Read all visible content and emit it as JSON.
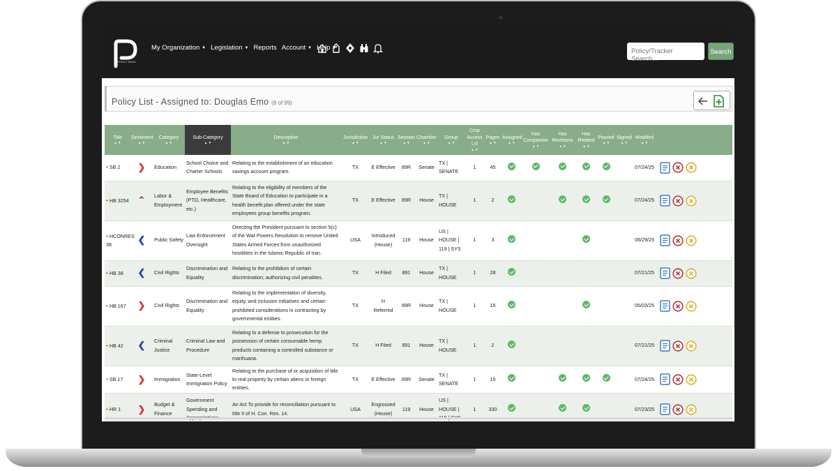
{
  "nav": {
    "brand": "POLICY RACE",
    "menu": [
      {
        "label": "My Organization",
        "caret": true
      },
      {
        "label": "Legislation",
        "caret": true
      },
      {
        "label": "Reports",
        "caret": false
      },
      {
        "label": "Account",
        "caret": true
      },
      {
        "label": "Help",
        "caret": true
      }
    ],
    "icons": [
      "home-icon",
      "tag-icon",
      "shapes-icon",
      "binoculars-icon",
      "bell-icon"
    ],
    "search_placeholder": "Policy/Tracker Search...",
    "search_button": "Search",
    "accent": "#7aa57a"
  },
  "page": {
    "title": "Policy List - Assigned to: Douglas Emo",
    "count": "(8 of 99)"
  },
  "table": {
    "header_color": "#88ad88",
    "sort_marker": "▲ ▼",
    "columns": [
      "Title",
      "Sentiment",
      "Category",
      "Sub-Category",
      "Description",
      "Jurisdiction",
      "Jur Status",
      "Session",
      "Chamber",
      "Group",
      "Cmp Access Lvl",
      "Pages",
      "Assigned",
      "Has Companion",
      "Has Revisions",
      "Has Related",
      "Passed",
      "Signed",
      "Modified"
    ],
    "rows": [
      {
        "title": "SB 2",
        "sentiment": "right",
        "category": "Education",
        "subcategory": "School Choice and Charter Schools",
        "description": "Relating to the establishment of an education savings account program.",
        "jurisdiction": "TX",
        "jur_status": "E Effective",
        "session": "89R",
        "chamber": "Senate",
        "group": "TX | SENATE",
        "access": "1",
        "pages": "45",
        "assigned": true,
        "companion": true,
        "revisions": true,
        "related": true,
        "passed": true,
        "signed": false,
        "modified": "07/24/25"
      },
      {
        "title": "HB 3254",
        "sentiment": "up",
        "category": "Labor & Employment",
        "subcategory": "Employee Benefits (PTO, Healthcare, etc.)",
        "description": "Relating to the eligibility of members of the State Board of Education to participate in a health benefit plan offered under the state employees group benefits program.",
        "jurisdiction": "TX",
        "jur_status": "E Effective",
        "session": "89R",
        "chamber": "House",
        "group": "TX | HOUSE",
        "access": "1",
        "pages": "2",
        "assigned": true,
        "companion": false,
        "revisions": true,
        "related": true,
        "passed": true,
        "signed": false,
        "modified": "07/24/25"
      },
      {
        "title": "HCONRES 38",
        "sentiment": "left",
        "category": "Public Safety",
        "subcategory": "Law Enforcement Oversight",
        "description": "Directing the President pursuant to section 5(c) of the War Powers Resolution to remove United States Armed Forces from unauthorized hostilities in the Islamic Republic of Iran.",
        "jurisdiction": "USA",
        "jur_status": "Introduced (House)",
        "session": "119",
        "chamber": "House",
        "group": "US | HOUSE | 119 | SYS",
        "access": "1",
        "pages": "3",
        "assigned": true,
        "companion": false,
        "revisions": false,
        "related": true,
        "passed": false,
        "signed": false,
        "modified": "06/29/25"
      },
      {
        "title": "HB 38",
        "sentiment": "left",
        "category": "Civil Rights",
        "subcategory": "Discrimination and Equality",
        "description": "Relating to the prohibition of certain discrimination; authorizing civil penalties.",
        "jurisdiction": "TX",
        "jur_status": "H Filed",
        "session": "891",
        "chamber": "House",
        "group": "TX | HOUSE",
        "access": "1",
        "pages": "28",
        "assigned": true,
        "companion": false,
        "revisions": false,
        "related": false,
        "passed": false,
        "signed": false,
        "modified": "07/21/25"
      },
      {
        "title": "HB 167",
        "sentiment": "right",
        "category": "Civil Rights",
        "subcategory": "Discrimination and Equality",
        "description": "Relating to the implementation of diversity, equity, and inclusion initiatives and certain prohibited considerations in contracting by governmental entities.",
        "jurisdiction": "TX",
        "jur_status": "H Referred",
        "session": "89R",
        "chamber": "House",
        "group": "TX | HOUSE",
        "access": "1",
        "pages": "15",
        "assigned": true,
        "companion": false,
        "revisions": false,
        "related": true,
        "passed": false,
        "signed": false,
        "modified": "05/03/25"
      },
      {
        "title": "HB 42",
        "sentiment": "left",
        "category": "Criminal Justice",
        "subcategory": "Criminal Law and Procedure",
        "description": "Relating to a defense to prosecution for the possession of certain consumable hemp products containing a controlled substance or marihuana.",
        "jurisdiction": "TX",
        "jur_status": "H Filed",
        "session": "891",
        "chamber": "House",
        "group": "TX | HOUSE",
        "access": "1",
        "pages": "2",
        "assigned": true,
        "companion": false,
        "revisions": false,
        "related": false,
        "passed": false,
        "signed": false,
        "modified": "07/21/25"
      },
      {
        "title": "SB 17",
        "sentiment": "right",
        "category": "Immigration",
        "subcategory": "State-Level Immigration Policy",
        "description": "Relating to the purchase of or acquisition of title to real property by certain aliens or foreign entities.",
        "jurisdiction": "TX",
        "jur_status": "E Effective",
        "session": "89R",
        "chamber": "Senate",
        "group": "TX | SENATE",
        "access": "1",
        "pages": "15",
        "assigned": true,
        "companion": false,
        "revisions": true,
        "related": true,
        "passed": true,
        "signed": false,
        "modified": "07/24/25"
      },
      {
        "title": "HR 1",
        "sentiment": "right",
        "category": "Budget & Finance",
        "subcategory": "Government Spending and Appropriations",
        "description": "An Act To provide for reconciliation pursuant to title II of H. Con. Res. 14.",
        "jurisdiction": "USA",
        "jur_status": "Engrossed (House)",
        "session": "119",
        "chamber": "House",
        "group": "US | HOUSE | 119 | SYS",
        "access": "1",
        "pages": "330",
        "assigned": true,
        "companion": false,
        "revisions": true,
        "related": true,
        "passed": false,
        "signed": false,
        "modified": "07/23/25"
      }
    ]
  }
}
